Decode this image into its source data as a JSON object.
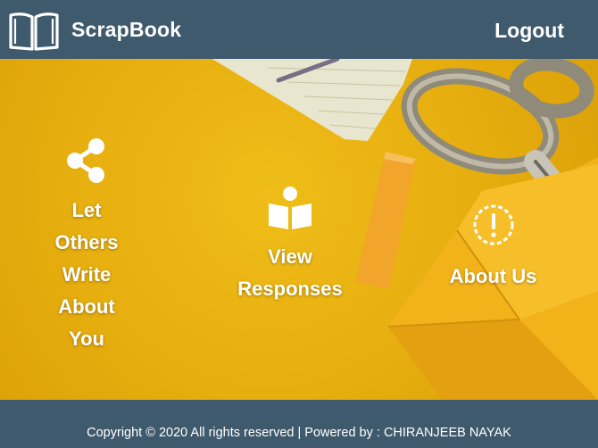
{
  "header": {
    "brand_name": "ScrapBook",
    "logout_label": "Logout"
  },
  "features": [
    {
      "label": "Let\nOthers\nWrite\nAbout\nYou",
      "icon": "share-icon"
    },
    {
      "label": "View\nResponses",
      "icon": "reader-book-icon"
    },
    {
      "label": "About Us",
      "icon": "exclamation-circle-icon"
    }
  ],
  "footer": {
    "text": "Copyright © 2020 All rights reserved | Powered by : CHIRANJEEB NAYAK"
  },
  "colors": {
    "header_bg": "#3f5a6d",
    "hero_bg": "#e8b20f",
    "text": "#ffffff"
  }
}
